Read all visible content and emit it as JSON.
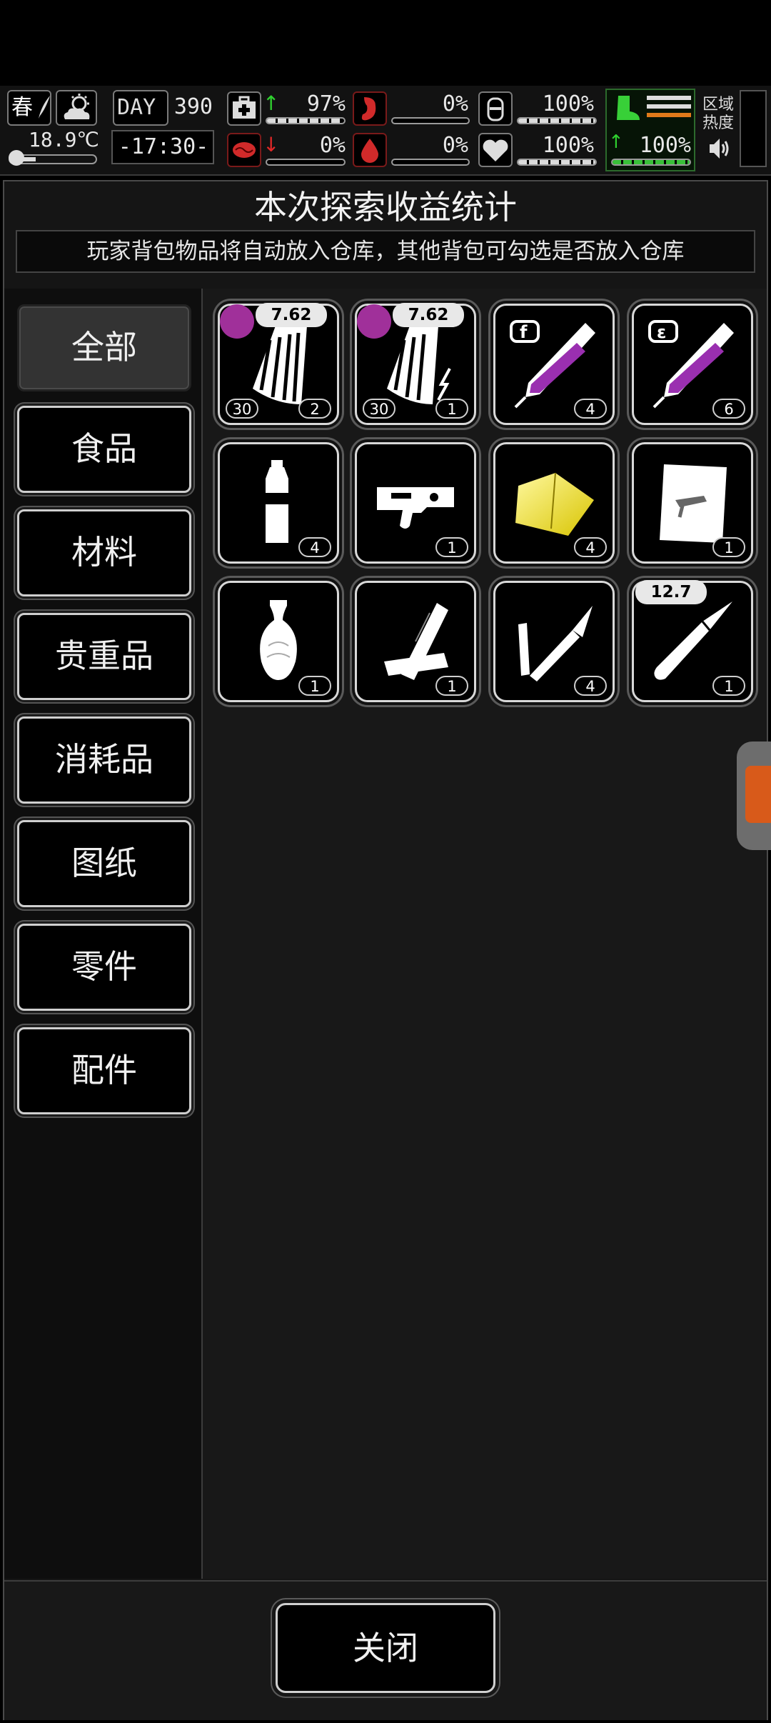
{
  "status": {
    "season": "春",
    "temperature": "18.9℃",
    "day_label": "DAY",
    "day": "390",
    "time": "-17:30-",
    "stats": {
      "health": "97%",
      "hunger": "0%",
      "oxygen": "100%",
      "mental": "0%",
      "bleeding": "0%",
      "heart": "100%",
      "stamina": "100%"
    },
    "stat_levels": {
      "health": 0.97,
      "hunger": 0,
      "oxygen": 1.0,
      "mental": 0,
      "bleeding": 0,
      "heart": 1.0,
      "stamina": 1.0
    },
    "region_heat_label": "区域\n热度",
    "colors": {
      "up_arrow": "#2fd12f",
      "down_arrow": "#e02828",
      "stamina_bar": "#38c038",
      "accent_red": "#e02828"
    }
  },
  "panel": {
    "title": "本次探索收益统计",
    "notice": "玩家背包物品将自动放入仓库，其他背包可勾选是否放入仓库"
  },
  "categories": [
    {
      "label": "全部",
      "active": true
    },
    {
      "label": "食品",
      "active": false
    },
    {
      "label": "材料",
      "active": false
    },
    {
      "label": "贵重品",
      "active": false
    },
    {
      "label": "消耗品",
      "active": false
    },
    {
      "label": "图纸",
      "active": false
    },
    {
      "label": "零件",
      "active": false
    },
    {
      "label": "配件",
      "active": false
    }
  ],
  "items": [
    {
      "icon": "rifle-magazine-icon",
      "caliber": "7.62",
      "ammo": "30",
      "count": "2"
    },
    {
      "icon": "rifle-magazine-electric-icon",
      "caliber": "7.62",
      "ammo": "30",
      "count": "1"
    },
    {
      "icon": "syringe-f-icon",
      "count": "4"
    },
    {
      "icon": "syringe-e-icon",
      "count": "6"
    },
    {
      "icon": "water-bottle-icon",
      "count": "4"
    },
    {
      "icon": "gun-trigger-part-icon",
      "count": "1"
    },
    {
      "icon": "yellow-cloth-icon",
      "count": "4"
    },
    {
      "icon": "blueprint-paper-icon",
      "count": "1"
    },
    {
      "icon": "porcelain-vase-icon",
      "count": "1"
    },
    {
      "icon": "wood-planks-icon",
      "count": "1"
    },
    {
      "icon": "glue-tube-icon",
      "count": "4"
    },
    {
      "icon": "bullet-icon",
      "caliber": "12.7",
      "count": "1"
    }
  ],
  "close_label": "关闭"
}
